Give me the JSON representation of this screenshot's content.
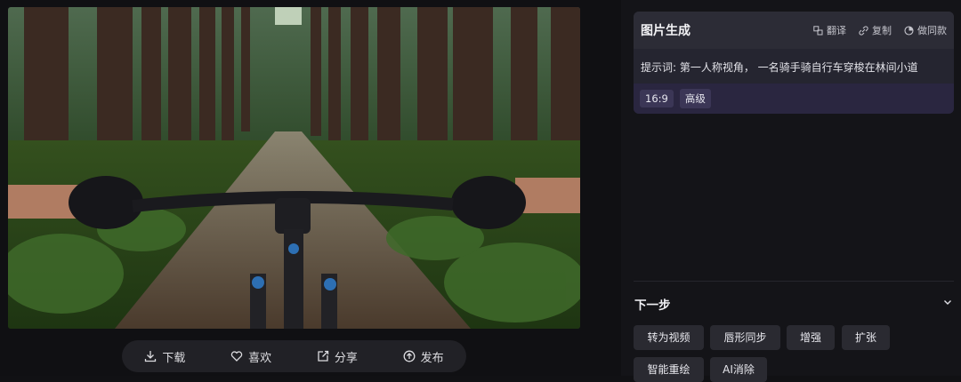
{
  "image_panel": {
    "alt": "第一人称视角骑自行车穿梭在林间小道",
    "actions": [
      {
        "label": "下载",
        "icon": "download-icon"
      },
      {
        "label": "喜欢",
        "icon": "heart-icon"
      },
      {
        "label": "分享",
        "icon": "share-icon"
      },
      {
        "label": "发布",
        "icon": "publish-icon"
      }
    ]
  },
  "prompt_card": {
    "title": "图片生成",
    "tools": [
      {
        "label": "翻译",
        "icon": "translate-icon"
      },
      {
        "label": "复制",
        "icon": "copy-icon"
      },
      {
        "label": "做同款",
        "icon": "remix-icon"
      }
    ],
    "prompt_text": "提示词: 第一人称视角， 一名骑手骑自行车穿梭在林间小道",
    "tags": [
      "16:9",
      "高级"
    ]
  },
  "next_step": {
    "title": "下一步",
    "buttons": [
      "转为视频",
      "唇形同步",
      "增强",
      "扩张",
      "智能重绘",
      "AI消除"
    ]
  },
  "colors": {
    "background": "#111114",
    "card": "#252530",
    "tag_bg": "#3b3656",
    "button_bg": "#2a2a31"
  }
}
